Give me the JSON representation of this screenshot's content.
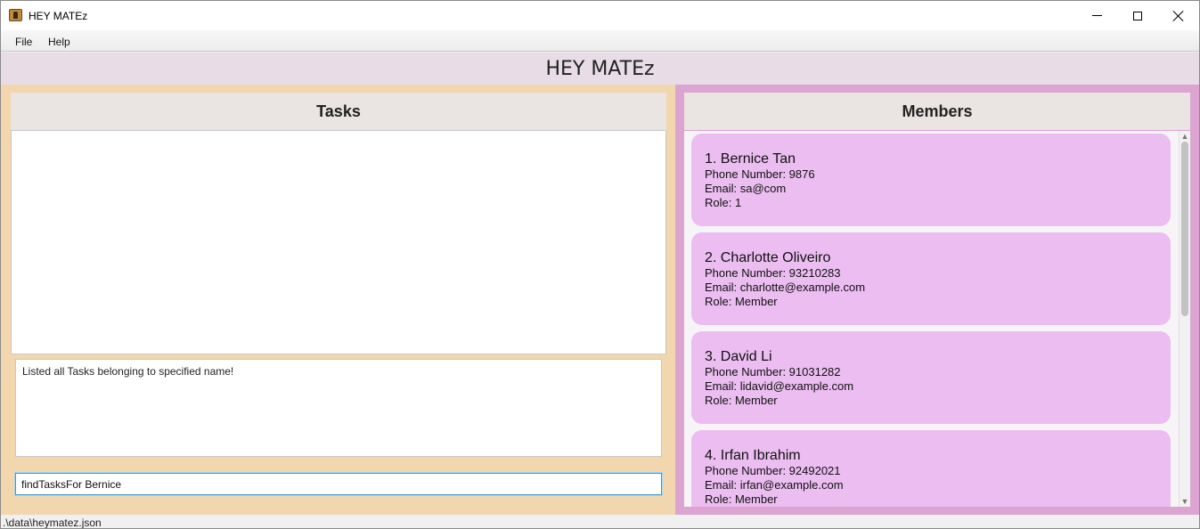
{
  "window": {
    "title": "HEY MATEz"
  },
  "menu": {
    "file": "File",
    "help": "Help"
  },
  "header": {
    "title": "HEY MATEz"
  },
  "tasks": {
    "heading": "Tasks",
    "result_message": "Listed all Tasks belonging to specified name!",
    "command_value": "findTasksFor Bernice"
  },
  "members": {
    "heading": "Members",
    "items": [
      {
        "name": "1.  Bernice Tan",
        "phone": "Phone Number: 9876",
        "email": "Email: sa@com",
        "role": "Role: 1"
      },
      {
        "name": "2.  Charlotte Oliveiro",
        "phone": "Phone Number: 93210283",
        "email": "Email: charlotte@example.com",
        "role": "Role: Member"
      },
      {
        "name": "3.  David Li",
        "phone": "Phone Number: 91031282",
        "email": "Email: lidavid@example.com",
        "role": "Role: Member"
      },
      {
        "name": "4.  Irfan Ibrahim",
        "phone": "Phone Number: 92492021",
        "email": "Email: irfan@example.com",
        "role": "Role: Member"
      }
    ]
  },
  "status": {
    "path": ".\\data\\heymatez.json"
  },
  "colors": {
    "tasks_panel_bg": "#f2d6ae",
    "members_panel_bg": "#dca4d1",
    "member_card_bg": "#ebbdf0",
    "header_bg": "#e8dde6"
  }
}
